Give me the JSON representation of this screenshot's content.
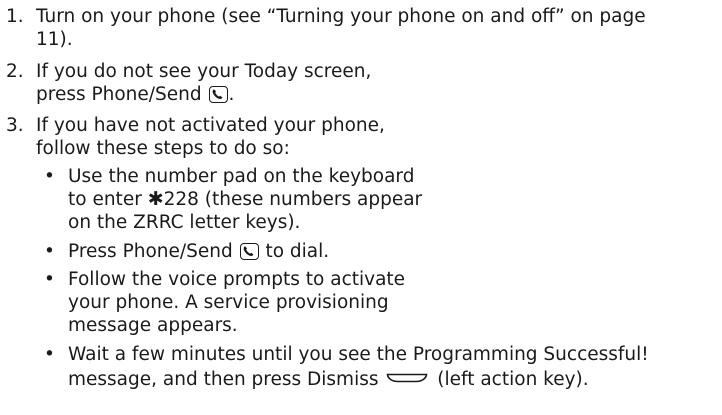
{
  "steps": [
    {
      "number": "1.",
      "lines": [
        "Turn on your phone (see “Turning your phone on and off” on page",
        "11)."
      ]
    },
    {
      "number": "2.",
      "line1": "If you do not see your Today screen,",
      "line2_before": "press Phone/Send",
      "line2_after": "."
    },
    {
      "number": "3.",
      "lines": [
        "If you have not activated your phone,",
        "follow these steps to do so:"
      ]
    }
  ],
  "bullets": [
    {
      "dot": "•",
      "line1": "Use the number pad on the keyboard",
      "line2_before": "to enter ",
      "line2_star": "✱",
      "line2_after": "228 (these numbers appear",
      "line3": "on the ZRRC letter keys)."
    },
    {
      "dot": "•",
      "line1_before": "Press Phone/Send",
      "line1_after": " to dial."
    },
    {
      "dot": "•",
      "lines": [
        "Follow the voice prompts to activate",
        "your phone. A service provisioning",
        "message appears."
      ]
    },
    {
      "dot": "•",
      "line1": "Wait a few minutes until you see the Programming Successful!",
      "line2_before": "message, and then press Dismiss",
      "line2_after": "(left action key)."
    }
  ],
  "icons": {
    "phone_send": "phone-send-key-icon",
    "dismiss": "left-action-key-icon"
  }
}
